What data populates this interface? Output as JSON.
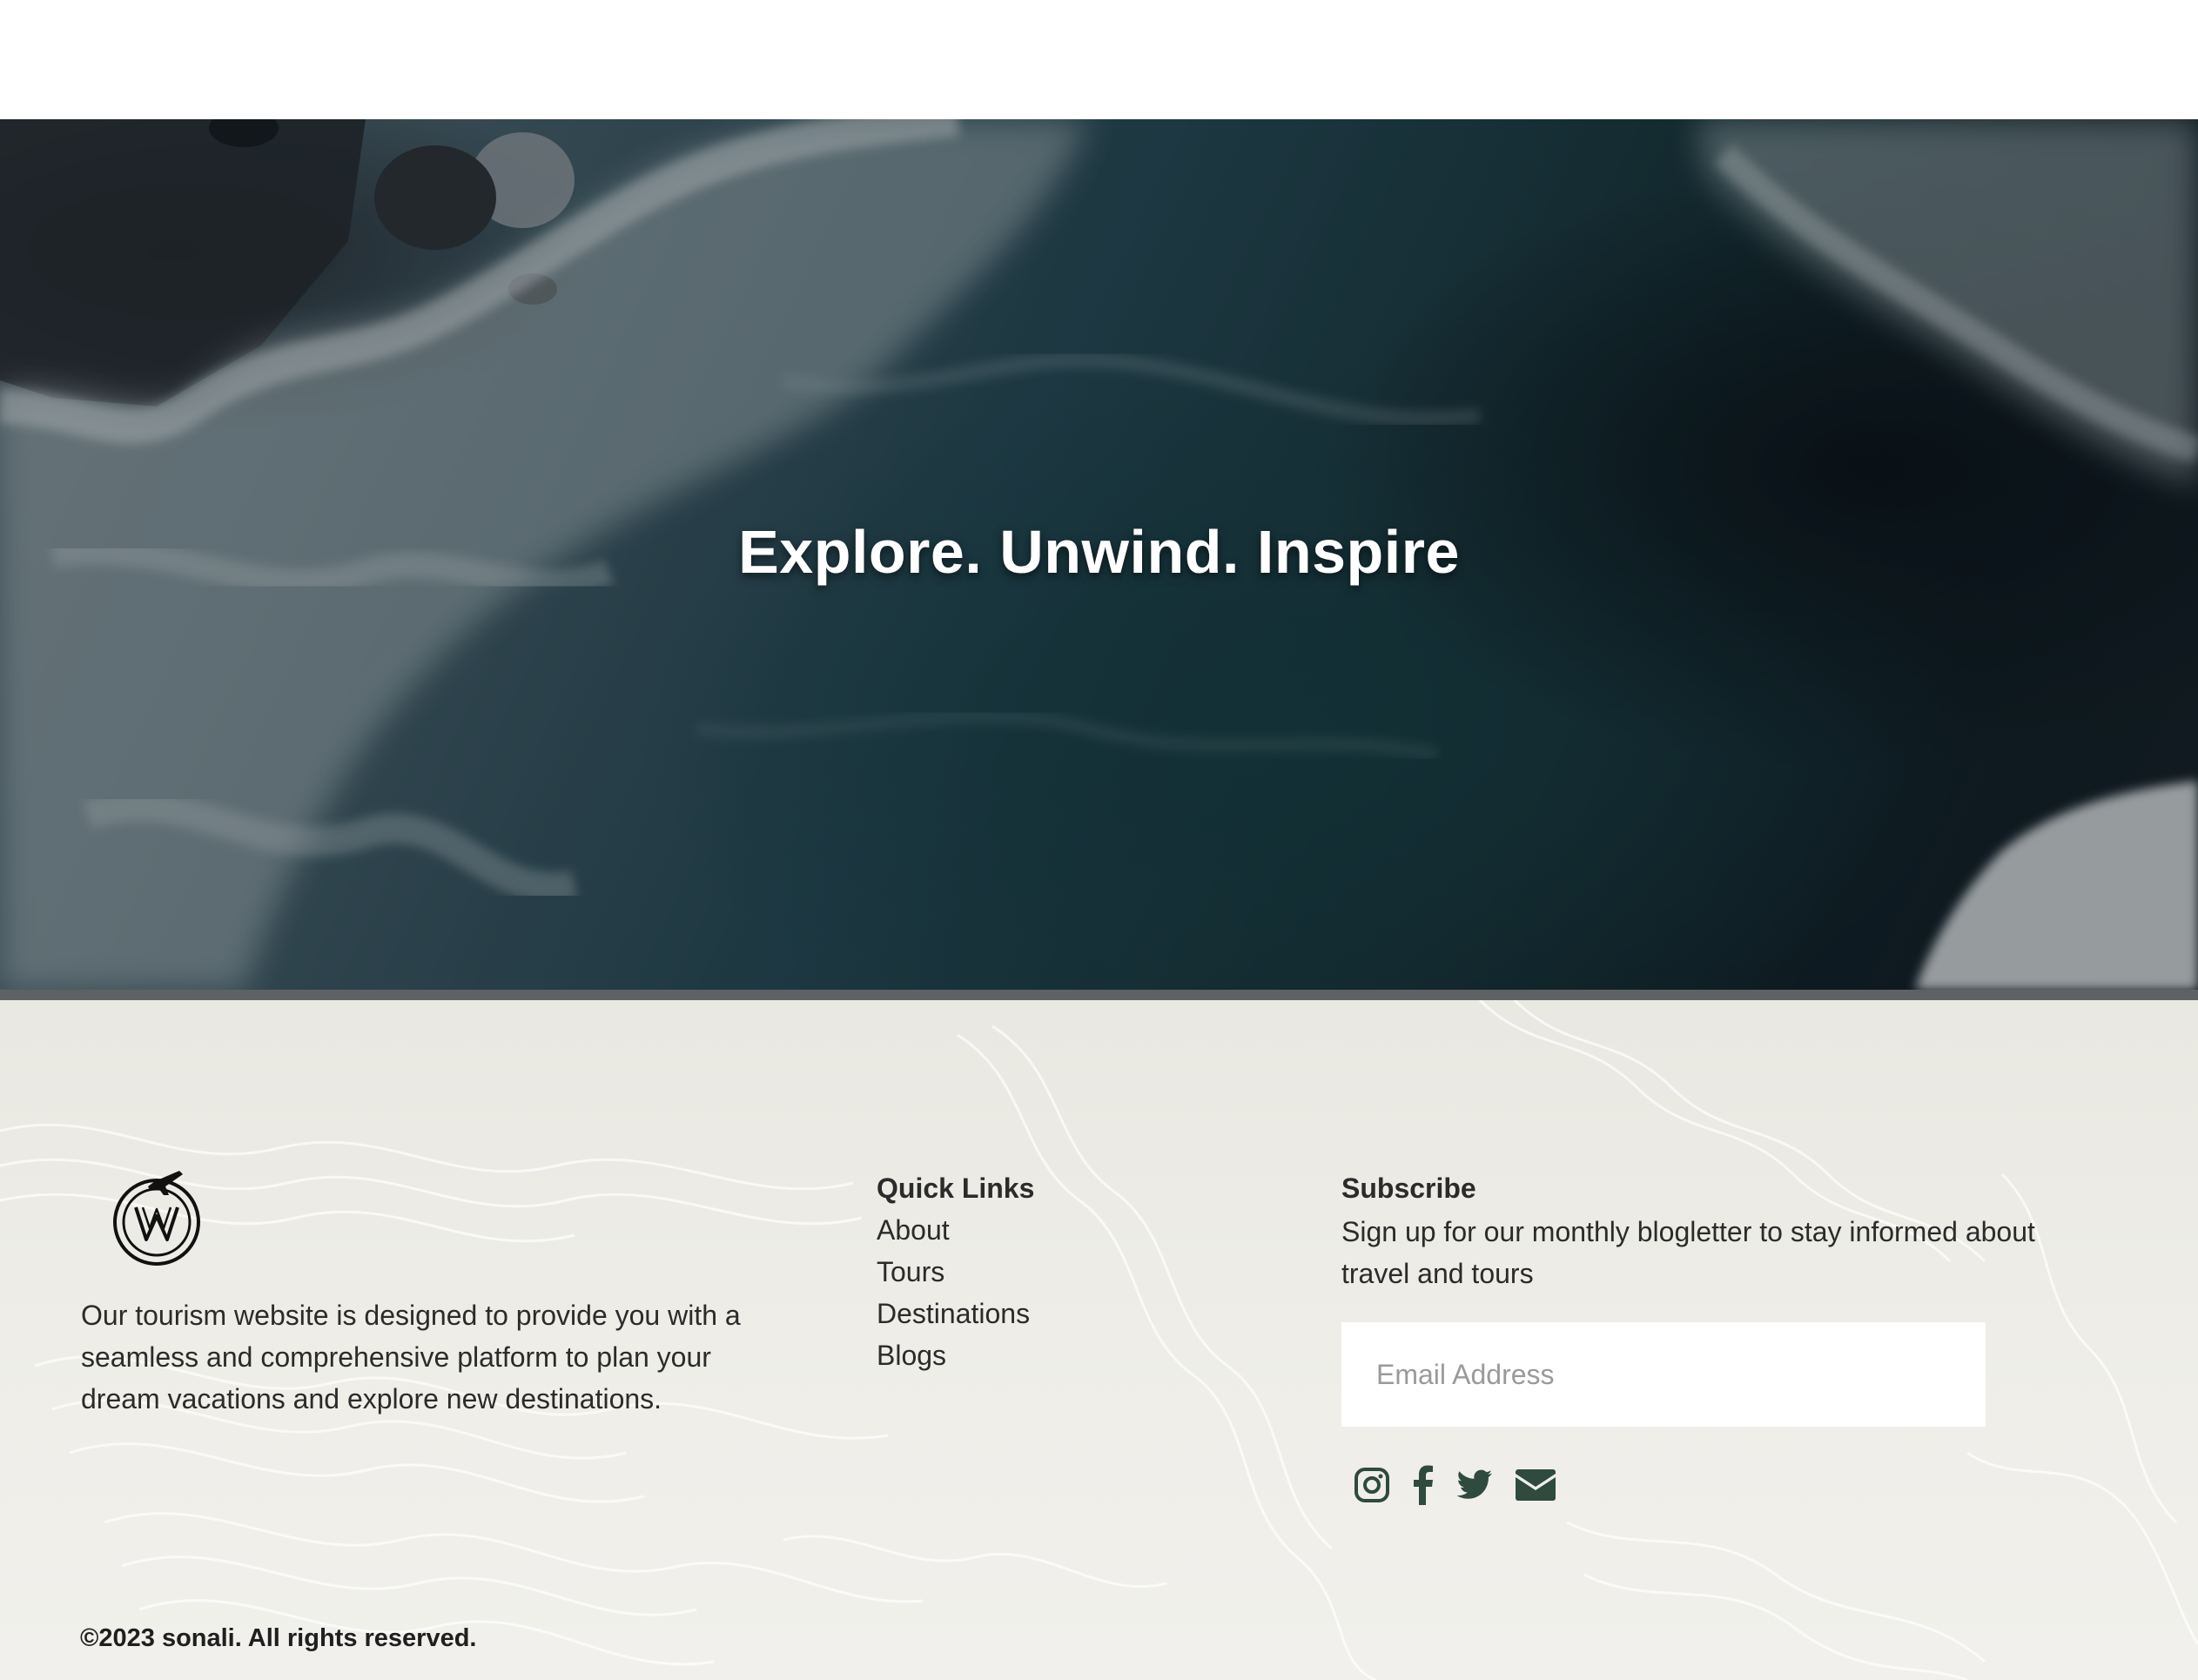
{
  "hero": {
    "title": "Explore. Unwind. Inspire"
  },
  "footer": {
    "about_text": "Our tourism website is designed to provide you with a seamless and comprehensive platform to plan your dream vacations and explore new destinations.",
    "quick_links": {
      "title": "Quick Links",
      "items": [
        "About",
        "Tours",
        "Destinations",
        "Blogs"
      ]
    },
    "subscribe": {
      "title": "Subscribe",
      "text": "Sign up for our monthly blogletter to stay informed about travel and tours",
      "email_placeholder": "Email Address"
    },
    "socials": [
      "instagram-icon",
      "facebook-icon",
      "twitter-icon",
      "envelope-icon"
    ],
    "copyright": "©2023 sonali. All rights reserved."
  },
  "colors": {
    "icon": "#2f4a3f",
    "text": "#2b2b2b",
    "footer_bg": "#ecebe5"
  }
}
